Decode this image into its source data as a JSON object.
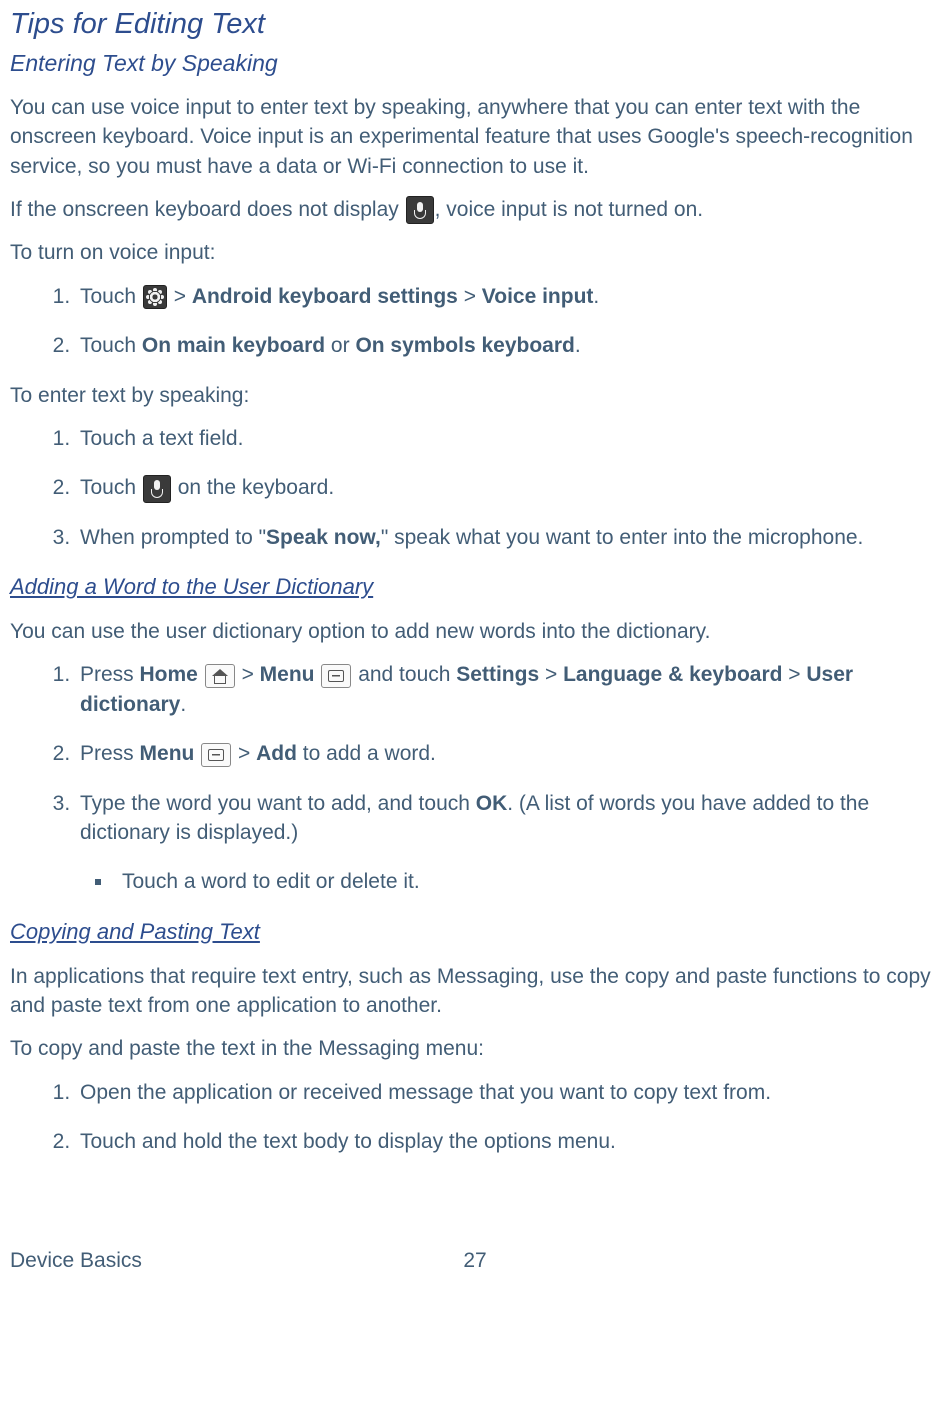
{
  "headings": {
    "h1": "Tips for Editing Text",
    "h2_entering": "Entering Text by Speaking",
    "h2_adding": "Adding a Word to the User Dictionary",
    "h2_copying": "Copying and Pasting Text"
  },
  "entering": {
    "p1": "You can use voice input to enter text by speaking, anywhere that you can enter text with the onscreen keyboard. Voice input is an experimental feature that uses Google's speech-recognition service, so you must have a data or Wi-Fi connection to use it.",
    "p2a": "If the onscreen keyboard does not display ",
    "p2b": ", voice input is not turned on.",
    "p3": "To turn on voice input:",
    "ol1": {
      "i1a": "Touch ",
      "i1b": " > ",
      "i1c": "Android keyboard settings",
      "i1d": " > ",
      "i1e": "Voice input",
      "i1f": ".",
      "i2a": "Touch ",
      "i2b": "On main keyboard",
      "i2c": " or ",
      "i2d": "On symbols keyboard",
      "i2e": "."
    },
    "p4": "To enter text by speaking:",
    "ol2": {
      "i1": "Touch a text field.",
      "i2a": "Touch ",
      "i2b": " on the keyboard.",
      "i3a": "When prompted to \"",
      "i3b": "Speak now,",
      "i3c": "\" speak what you want to enter into the microphone."
    }
  },
  "adding": {
    "p1": "You can use the user dictionary option to add new words into the dictionary.",
    "ol": {
      "i1a": "Press ",
      "i1b": "Home",
      "i1c": " > ",
      "i1d": "Menu",
      "i1e": " and touch ",
      "i1f": "Settings",
      "i1g": " > ",
      "i1h": "Language & keyboard",
      "i1i": " > ",
      "i1j": "User dictionary",
      "i1k": ".",
      "i2a": "Press ",
      "i2b": "Menu",
      "i2c": " > ",
      "i2d": "Add",
      "i2e": " to add a word.",
      "i3a": "Type the word you want to add, and touch ",
      "i3b": "OK",
      "i3c": ". (A list of words you have added to the dictionary is displayed.)"
    },
    "ul": {
      "i1": "Touch a word to edit or delete it."
    }
  },
  "copying": {
    "p1": "In applications that require text entry, such as Messaging, use the copy and paste functions to copy and paste text from one application to another.",
    "p2": "To copy and paste the text in the Messaging menu:",
    "ol": {
      "i1": "Open the application or received message that you want to copy text from.",
      "i2": "Touch and hold the text body to display the options menu."
    }
  },
  "footer": {
    "left": "Device Basics",
    "page": "27"
  }
}
